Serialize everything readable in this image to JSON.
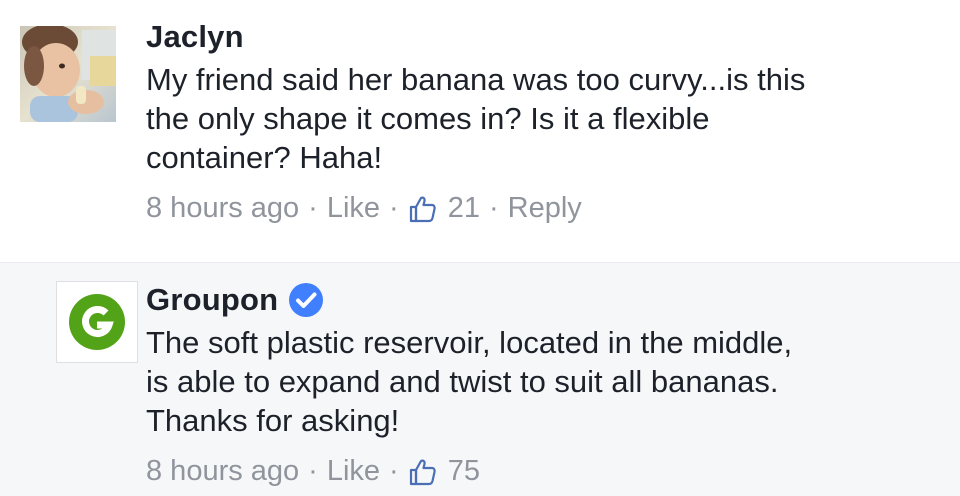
{
  "comments": [
    {
      "author": "Jaclyn",
      "text": "My friend said her banana was too curvy...is this\nthe only shape it comes in? Is it a flexible\ncontainer? Haha!",
      "time": "8 hours ago",
      "like_label": "Like",
      "like_count": "21",
      "reply_label": "Reply",
      "avatar_icon": "child-photo-avatar"
    },
    {
      "author": "Groupon",
      "verified": true,
      "text": "The soft plastic reservoir, located in the middle,\nis able to expand and twist to suit all bananas.\nThanks for asking!",
      "time": "8 hours ago",
      "like_label": "Like",
      "like_count": "75",
      "avatar_icon": "groupon-g-logo",
      "brand_color": "#53a318",
      "verified_color": "#4080ff"
    }
  ],
  "separator": "·"
}
